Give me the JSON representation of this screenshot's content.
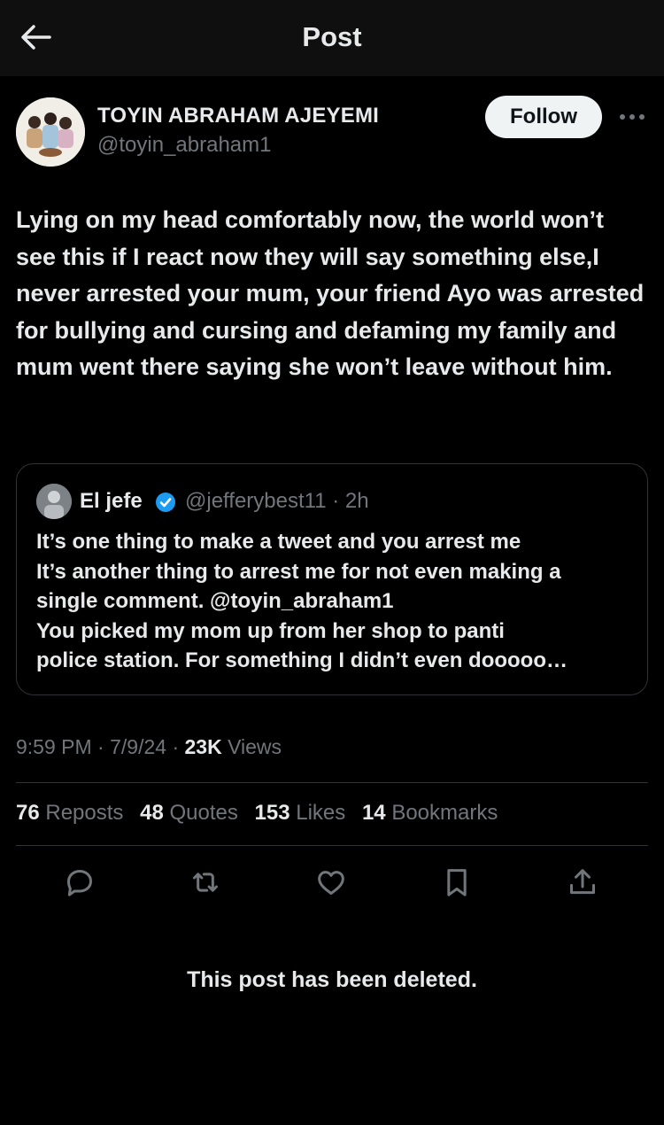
{
  "header": {
    "title": "Post"
  },
  "author": {
    "name": "TOYIN ABRAHAM AJEYEMI",
    "handle": "@toyin_abraham1",
    "follow_label": "Follow"
  },
  "post": {
    "text": "Lying on my head comfortably now, the world won’t see this if I react now they will say something else,I never arrested your mum, your friend Ayo was arrested for bullying and cursing and defaming my family and mum went there saying she won’t leave without him.",
    "time": "9:59 PM",
    "date": "7/9/24",
    "views_count": "23K",
    "views_label": "Views"
  },
  "quote": {
    "name": "El jefe",
    "handle": "@jefferybest11",
    "age": "2h",
    "lines": [
      "It’s one thing to make a tweet and you arrest me",
      "It’s another thing to arrest me for not even making a",
      "single comment. @toyin_abraham1",
      "You picked my mom up from her shop to panti",
      "police station. For something I didn’t even dooooo…"
    ]
  },
  "stats": [
    {
      "count": "76",
      "label": "Reposts"
    },
    {
      "count": "48",
      "label": "Quotes"
    },
    {
      "count": "153",
      "label": "Likes"
    },
    {
      "count": "14",
      "label": "Bookmarks"
    }
  ],
  "actions": [
    "reply-icon",
    "repost-icon",
    "like-icon",
    "bookmark-icon",
    "share-icon"
  ],
  "deleted_notice": "This post has been deleted.",
  "colors": {
    "background": "#000000",
    "header_background": "#0f0f0f",
    "text": "#e7e9ea",
    "muted": "#71767b",
    "border": "#2f3336",
    "verified": "#1d9bf0"
  }
}
